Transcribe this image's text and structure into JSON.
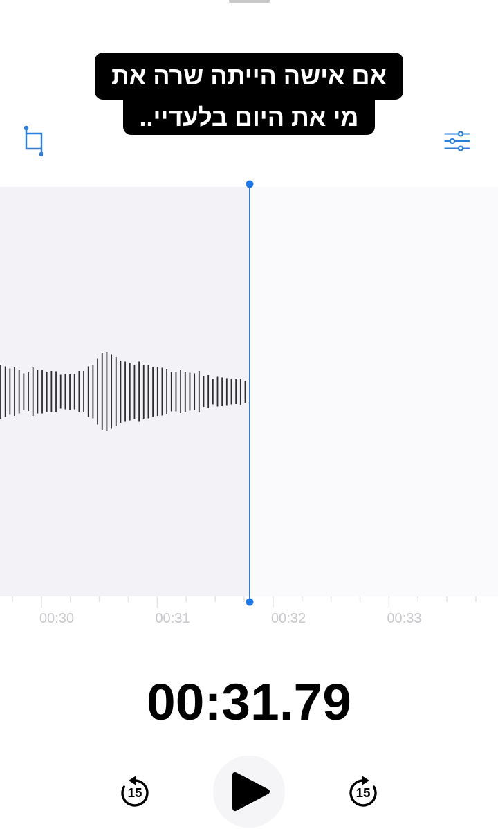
{
  "caption": {
    "lines": [
      "אם אישה הייתה שרה את",
      "מי את היום בלעדיי.."
    ]
  },
  "timeline": {
    "labels": [
      "00:30",
      "00:31",
      "00:32",
      "00:33"
    ]
  },
  "elapsed_time": "00:31.79",
  "transport": {
    "playing": false,
    "skip_back": "15",
    "skip_forward": "15"
  }
}
